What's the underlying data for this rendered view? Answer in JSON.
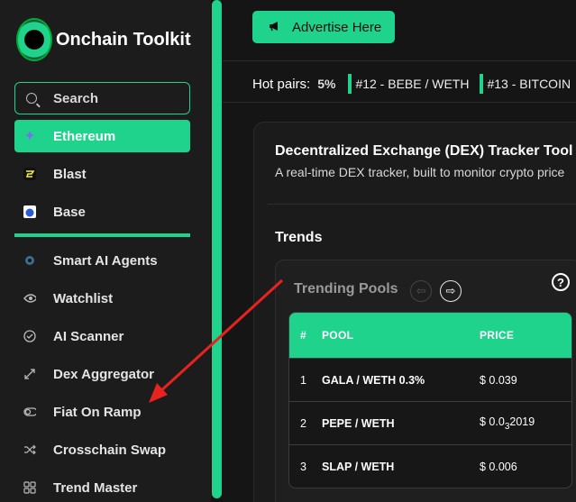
{
  "sidebar": {
    "logo_text": "Onchain Toolkit",
    "search_label": "Search",
    "items": [
      {
        "label": "Ethereum",
        "icon": "ethereum-icon",
        "active": true
      },
      {
        "label": "Blast",
        "icon": "blast-icon"
      },
      {
        "label": "Base",
        "icon": "base-icon"
      },
      {
        "label": "Smart AI Agents",
        "icon": "ai-agent-icon"
      },
      {
        "label": "Watchlist",
        "icon": "eye-icon"
      },
      {
        "label": "AI Scanner",
        "icon": "check-circle-icon"
      },
      {
        "label": "Dex Aggregator",
        "icon": "aggregator-icon"
      },
      {
        "label": "Fiat On Ramp",
        "icon": "toggle-icon"
      },
      {
        "label": "Crosschain Swap",
        "icon": "shuffle-icon"
      },
      {
        "label": "Trend Master",
        "icon": "grid-icon"
      }
    ]
  },
  "topbar": {
    "advertise_label": "Advertise Here",
    "hot_label": "Hot pairs:",
    "hot_pct": "5%",
    "pairs": [
      "#12 - BEBE / WETH",
      "#13 - BITCOIN"
    ]
  },
  "main": {
    "title": "Decentralized Exchange (DEX) Tracker Tool",
    "subtitle": "A real-time DEX tracker, built to monitor crypto price",
    "trends_heading": "Trends",
    "trending_pools_label": "Trending Pools",
    "help_symbol": "?",
    "table": {
      "headers": [
        "#",
        "POOL",
        "PRICE"
      ],
      "rows": [
        {
          "num": "1",
          "pool": "GALA / WETH 0.3%",
          "price": "$ 0.039"
        },
        {
          "num": "2",
          "pool": "PEPE / WETH",
          "price_prefix": "$ 0.0",
          "price_sub": "3",
          "price_suffix": "2019"
        },
        {
          "num": "3",
          "pool": "SLAP / WETH",
          "price": "$ 0.006"
        }
      ]
    }
  },
  "colors": {
    "accent": "#1fd38c",
    "background": "#151515",
    "sidebar": "#1c1c1c",
    "annotation_arrow": "#e8231f"
  }
}
